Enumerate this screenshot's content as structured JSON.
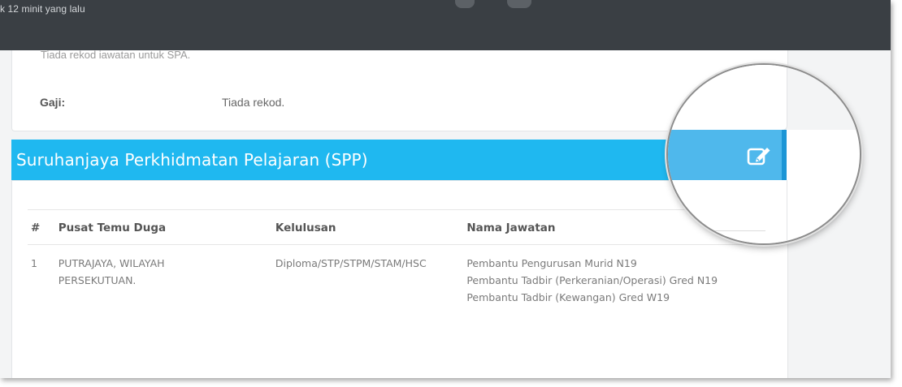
{
  "topbar": {
    "time_text": "k 12 minit yang lalu"
  },
  "previous_section": {
    "note": "Tiada rekod jawatan untuk SPA.",
    "salary_label": "Gaji:",
    "salary_value": "Tiada rekod."
  },
  "spp": {
    "title": "Suruhanjaya Perkhidmatan Pelajaran (SPP)",
    "edit_icon": "edit-icon",
    "table": {
      "headers": [
        "#",
        "Pusat Temu Duga",
        "Kelulusan",
        "Nama Jawatan"
      ],
      "rows": [
        {
          "num": "1",
          "pusat": "PUTRAJAYA, WILAYAH PERSEKUTUAN.",
          "kelulusan": "Diploma/STP/STPM/STAM/HSC",
          "jawatan": [
            "Pembantu Pengurusan Murid N19",
            "Pembantu Tadbir (Perkeranian/Operasi) Gred N19",
            "Pembantu Tadbir (Kewangan) Gred W19"
          ]
        }
      ]
    }
  },
  "colors": {
    "topbar": "#3a3f44",
    "header_band": "#1fb8f0",
    "magnified_band": "#4fb8ec"
  }
}
